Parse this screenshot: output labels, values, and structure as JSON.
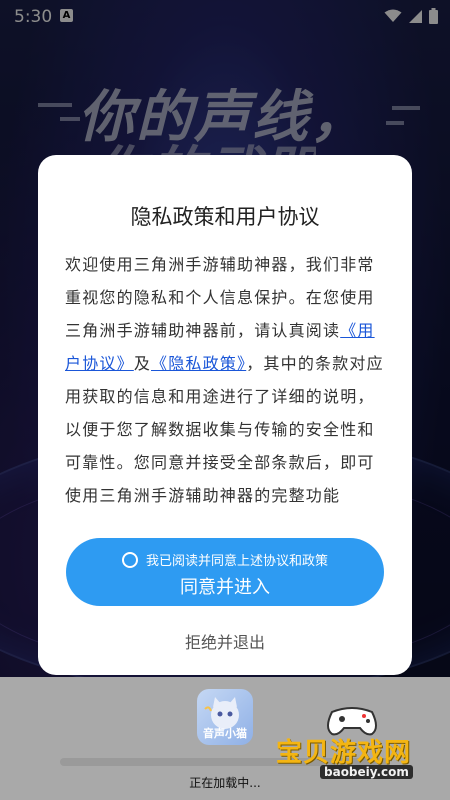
{
  "status_bar": {
    "time": "5:30",
    "notification_badge": "A"
  },
  "background": {
    "slogan_line1": "你的声线，",
    "slogan_line2": "你的武器"
  },
  "dialog": {
    "title": "隐私政策和用户协议",
    "body_part1": "欢迎使用三角洲手游辅助神器，我们非常重视您的隐私和个人信息保护。在您使用三角洲手游辅助神器前，请认真阅读",
    "user_agreement_link": "《用户协议》",
    "body_and": "及",
    "privacy_policy_link": "《隐私政策》",
    "body_part2": "，其中的条款对应用获取的信息和用途进行了详细的说明，以便于您了解数据收集与传输的安全性和可靠性。您同意并接受全部条款后，即可使用三角洲手游辅助神器的完整功能",
    "agree_checkbox_label": "我已阅读并同意上述协议和政策",
    "agree_button_label": "同意并进入",
    "reject_button_label": "拒绝并退出"
  },
  "loading": {
    "app_icon_text": "音声小猫",
    "status_text": "正在加载中..."
  },
  "watermark": {
    "title": "宝贝游戏网",
    "url": "baobeiy.com"
  },
  "colors": {
    "primary_button": "#2e9bf2",
    "link": "#1a56d8",
    "watermark_title": "#f4b512"
  }
}
